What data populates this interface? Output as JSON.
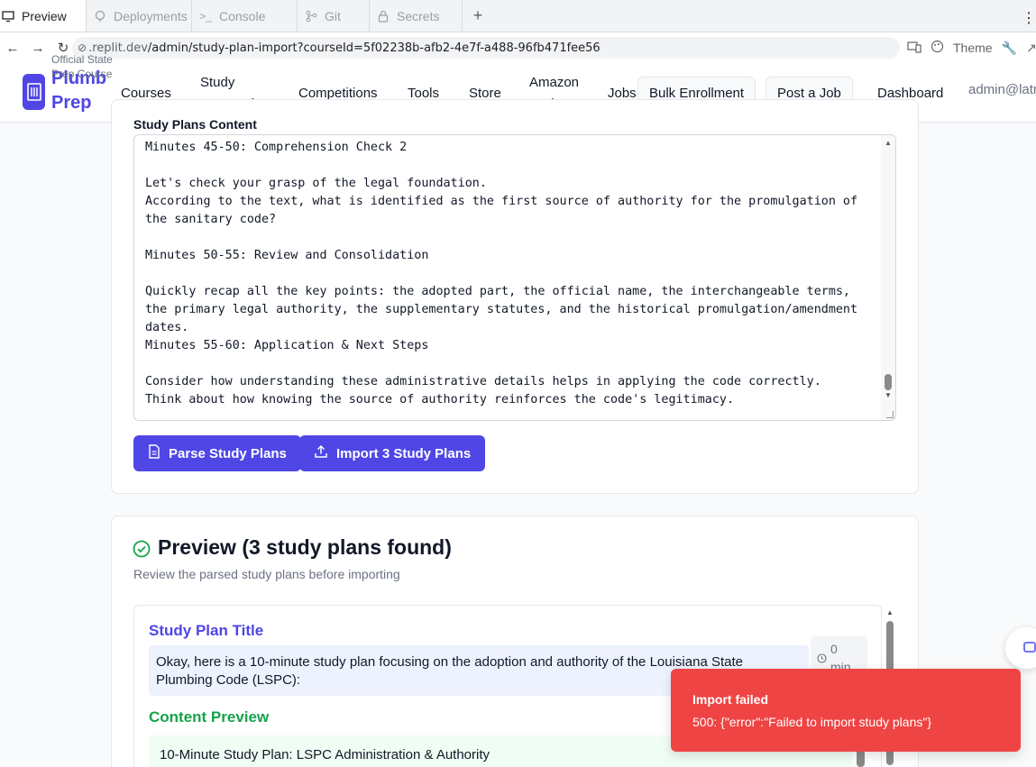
{
  "browser": {
    "tabs": [
      {
        "label": "Preview",
        "icon": "monitor-icon",
        "active": true
      },
      {
        "label": "Deployments",
        "icon": "deploy-icon",
        "active": false
      },
      {
        "label": "Console",
        "icon": "terminal-icon",
        "active": false
      },
      {
        "label": "Git",
        "icon": "git-icon",
        "active": false
      },
      {
        "label": "Secrets",
        "icon": "lock-icon",
        "active": false
      }
    ],
    "new_tab": "+",
    "url_host": ".replit.dev",
    "url_path": "/admin/study-plan-import?courseId=5f02238b-afb2-4e7f-a488-96fb471fee56",
    "theme_label": "Theme"
  },
  "header": {
    "brand_name": "Plumb Prep",
    "brand_sub": "Official State Prep Course",
    "nav": {
      "courses": "Courses",
      "study_companion": "Study Companion",
      "competitions": "Competitions",
      "tools": "Tools",
      "store": "Store",
      "amazon_tools": "Amazon Tools",
      "jobs": "Jobs"
    },
    "bulk_enrollment": "Bulk Enrollment",
    "post_job": "Post a Job",
    "dashboard": "Dashboard",
    "user": "admin@latr"
  },
  "import_card": {
    "field_label": "Study Plans Content",
    "textarea_value": "memorizing each number unless specifically asked.\nMinutes 45-50: Comprehension Check 2\n\nLet's check your grasp of the legal foundation.\nAccording to the text, what is identified as the first source of authority for the promulgation of the sanitary code?\n\nMinutes 50-55: Review and Consolidation\n\nQuickly recap all the key points: the adopted part, the official name, the interchangeable terms, the primary legal authority, the supplementary statutes, and the historical promulgation/amendment dates.\nMinutes 55-60: Application & Next Steps\n\nConsider how understanding these administrative details helps in applying the code correctly.\nThink about how knowing the source of authority reinforces the code's legitimacy.",
    "parse_button": "Parse Study Plans",
    "import_button": "Import 3 Study Plans"
  },
  "preview": {
    "title": "Preview (3 study plans found)",
    "subtitle": "Review the parsed study plans before importing",
    "plan_title_label": "Study Plan Title",
    "plan_title_value": "Okay, here is a 10-minute study plan focusing on the adoption and authority of the Louisiana State Plumbing Code (LSPC):",
    "duration_value": "0",
    "duration_unit": "min",
    "content_label": "Content Preview",
    "content_value": "10-Minute Study Plan: LSPC Administration & Authority"
  },
  "toast": {
    "title": "Import failed",
    "message": "500: {\"error\":\"Failed to import study plans\"}"
  },
  "colors": {
    "primary": "#4f46e5",
    "success": "#16a34a",
    "error": "#ef4444"
  }
}
